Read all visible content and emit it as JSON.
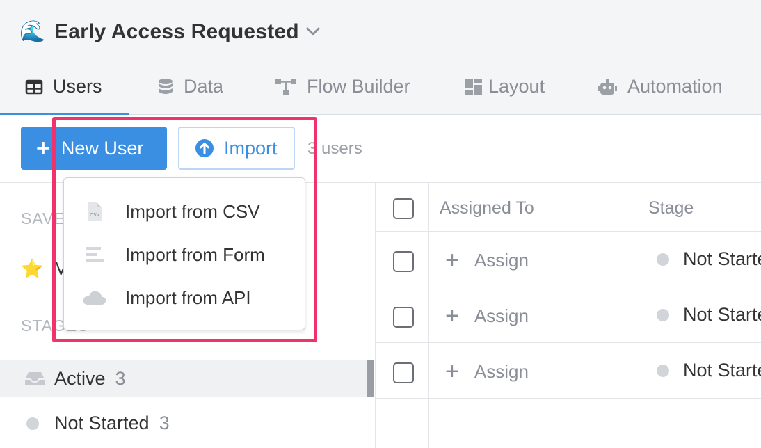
{
  "header": {
    "emoji": "🌊",
    "title": "Early Access Requested"
  },
  "tabs": [
    {
      "label": "Users",
      "icon": "table-icon",
      "active": true
    },
    {
      "label": "Data",
      "icon": "database-icon"
    },
    {
      "label": "Flow Builder",
      "icon": "flow-icon"
    },
    {
      "label": "Layout",
      "icon": "layout-icon"
    },
    {
      "label": "Automation",
      "icon": "robot-icon"
    }
  ],
  "toolbar": {
    "new_user_label": "New User",
    "import_label": "Import",
    "user_count": "3 users"
  },
  "import_menu": {
    "items": [
      {
        "label": "Import from CSV",
        "icon": "csv-file-icon"
      },
      {
        "label": "Import from Form",
        "icon": "form-icon"
      },
      {
        "label": "Import from API",
        "icon": "cloud-icon"
      }
    ]
  },
  "sidebar": {
    "saved_label": "SAVED",
    "star_item": {
      "emoji": "⭐",
      "label": "My"
    },
    "stages_label": "STAGES",
    "stages": [
      {
        "label": "Active",
        "count": "3"
      },
      {
        "label": "Not Started",
        "count": "3"
      }
    ]
  },
  "table": {
    "columns": [
      "Assigned To",
      "Stage"
    ],
    "rows": [
      {
        "assign": "Assign",
        "stage": "Not Started"
      },
      {
        "assign": "Assign",
        "stage": "Not Started"
      },
      {
        "assign": "Assign",
        "stage": "Not Started"
      }
    ]
  },
  "colors": {
    "accent": "#3b8fe3",
    "highlight": "#f0336d",
    "status_dot": "#d1d4d8"
  }
}
